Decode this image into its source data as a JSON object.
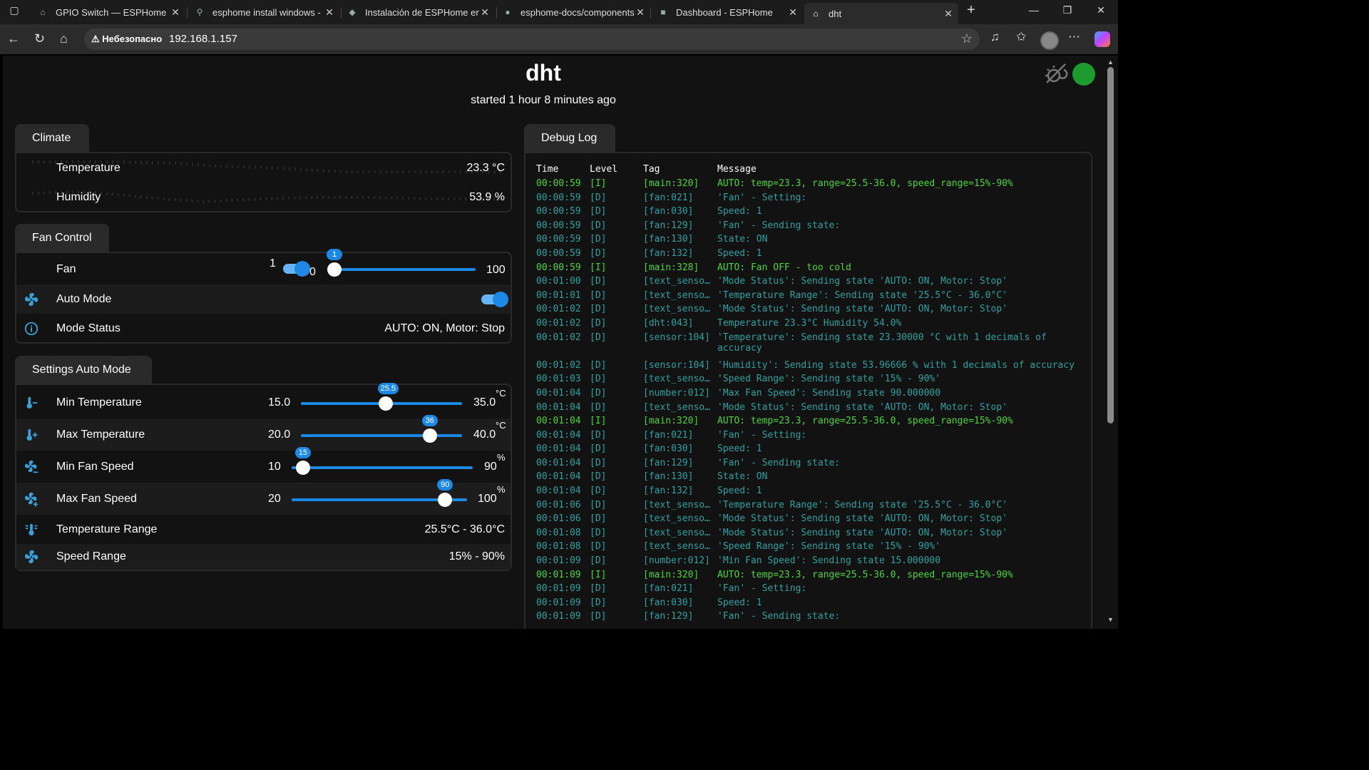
{
  "browser": {
    "tabs": [
      {
        "title": "GPIO Switch — ESPHome",
        "icon": "esphome-icon"
      },
      {
        "title": "esphome install windows - I",
        "icon": "search-icon"
      },
      {
        "title": "Instalación de ESPHome en r",
        "icon": "site-icon"
      },
      {
        "title": "esphome-docs/components",
        "icon": "github-icon"
      },
      {
        "title": "Dashboard - ESPHome",
        "icon": "esphome-icon"
      },
      {
        "title": "dht",
        "icon": "home-icon"
      }
    ],
    "security_label": "Небезопасно",
    "url": "192.168.1.157"
  },
  "page": {
    "title": "dht",
    "subtitle": "started 1 hour 8 minutes ago"
  },
  "climate": {
    "tab": "Climate",
    "temperature_label": "Temperature",
    "temperature_value": "23.3 °C",
    "humidity_label": "Humidity",
    "humidity_value": "53.9 %"
  },
  "fan_control": {
    "tab": "Fan Control",
    "fan_label": "Fan",
    "fan_toggle_left": "1",
    "fan_toggle_right": "0",
    "fan_speed_value": "1",
    "fan_speed_max": "100",
    "fan_speed_fraction": 0.0,
    "auto_mode_label": "Auto Mode",
    "auto_mode_on": true,
    "mode_status_label": "Mode Status",
    "mode_status_value": "AUTO: ON, Motor: Stop"
  },
  "settings": {
    "tab": "Settings Auto Mode",
    "sliders": [
      {
        "label": "Min Temperature",
        "min": "15.0",
        "max": "35.0",
        "value": "25.5",
        "unit": "°C",
        "fraction": 0.525
      },
      {
        "label": "Max Temperature",
        "min": "20.0",
        "max": "40.0",
        "value": "36",
        "unit": "°C",
        "fraction": 0.8
      },
      {
        "label": "Min Fan Speed",
        "min": "10",
        "max": "90",
        "value": "15",
        "unit": "%",
        "fraction": 0.0625
      },
      {
        "label": "Max Fan Speed",
        "min": "20",
        "max": "100",
        "value": "90",
        "unit": "%",
        "fraction": 0.875
      }
    ],
    "temp_range_label": "Temperature Range",
    "temp_range_value": "25.5°C - 36.0°C",
    "speed_range_label": "Speed Range",
    "speed_range_value": "15% - 90%"
  },
  "debug_log": {
    "tab": "Debug Log",
    "headers": [
      "Time",
      "Level",
      "Tag",
      "Message"
    ],
    "rows": [
      {
        "time": "00:00:59",
        "level": "[I]",
        "tag": "[main:320]",
        "msg": "AUTO: temp=23.3, range=25.5-36.0, speed_range=15%-90%"
      },
      {
        "time": "00:00:59",
        "level": "[D]",
        "tag": "[fan:021]",
        "msg": "'Fan' - Setting:"
      },
      {
        "time": "00:00:59",
        "level": "[D]",
        "tag": "[fan:030]",
        "msg": "Speed: 1"
      },
      {
        "time": "00:00:59",
        "level": "[D]",
        "tag": "[fan:129]",
        "msg": "'Fan' - Sending state:"
      },
      {
        "time": "00:00:59",
        "level": "[D]",
        "tag": "[fan:130]",
        "msg": "State: ON"
      },
      {
        "time": "00:00:59",
        "level": "[D]",
        "tag": "[fan:132]",
        "msg": "Speed: 1"
      },
      {
        "time": "00:00:59",
        "level": "[I]",
        "tag": "[main:328]",
        "msg": "AUTO: Fan OFF - too cold"
      },
      {
        "time": "00:01:00",
        "level": "[D]",
        "tag": "[text_senso…",
        "msg": "'Mode Status': Sending state 'AUTO: ON, Motor: Stop'"
      },
      {
        "time": "00:01:01",
        "level": "[D]",
        "tag": "[text_senso…",
        "msg": "'Temperature Range': Sending state '25.5°C - 36.0°C'"
      },
      {
        "time": "00:01:02",
        "level": "[D]",
        "tag": "[text_senso…",
        "msg": "'Mode Status': Sending state 'AUTO: ON, Motor: Stop'"
      },
      {
        "time": "00:01:02",
        "level": "[D]",
        "tag": "[dht:043]",
        "msg": "Temperature 23.3°C Humidity 54.0%"
      },
      {
        "time": "00:01:02",
        "level": "[D]",
        "tag": "[sensor:104]",
        "msg": "'Temperature': Sending state 23.30000 °C with 1 decimals of\naccuracy"
      },
      {
        "time": "00:01:02",
        "level": "[D]",
        "tag": "[sensor:104]",
        "msg": "'Humidity': Sending state 53.96666 % with 1 decimals of accuracy"
      },
      {
        "time": "00:01:03",
        "level": "[D]",
        "tag": "[text_senso…",
        "msg": "'Speed Range': Sending state '15% - 90%'"
      },
      {
        "time": "00:01:04",
        "level": "[D]",
        "tag": "[number:012]",
        "msg": "'Max Fan Speed': Sending state 90.000000"
      },
      {
        "time": "00:01:04",
        "level": "[D]",
        "tag": "[text_senso…",
        "msg": "'Mode Status': Sending state 'AUTO: ON, Motor: Stop'"
      },
      {
        "time": "00:01:04",
        "level": "[I]",
        "tag": "[main:320]",
        "msg": "AUTO: temp=23.3, range=25.5-36.0, speed_range=15%-90%"
      },
      {
        "time": "00:01:04",
        "level": "[D]",
        "tag": "[fan:021]",
        "msg": "'Fan' - Setting:"
      },
      {
        "time": "00:01:04",
        "level": "[D]",
        "tag": "[fan:030]",
        "msg": "Speed: 1"
      },
      {
        "time": "00:01:04",
        "level": "[D]",
        "tag": "[fan:129]",
        "msg": "'Fan' - Sending state:"
      },
      {
        "time": "00:01:04",
        "level": "[D]",
        "tag": "[fan:130]",
        "msg": "State: ON"
      },
      {
        "time": "00:01:04",
        "level": "[D]",
        "tag": "[fan:132]",
        "msg": "Speed: 1"
      },
      {
        "time": "00:01:06",
        "level": "[D]",
        "tag": "[text_senso…",
        "msg": "'Temperature Range': Sending state '25.5°C - 36.0°C'"
      },
      {
        "time": "00:01:06",
        "level": "[D]",
        "tag": "[text_senso…",
        "msg": "'Mode Status': Sending state 'AUTO: ON, Motor: Stop'"
      },
      {
        "time": "00:01:08",
        "level": "[D]",
        "tag": "[text_senso…",
        "msg": "'Mode Status': Sending state 'AUTO: ON, Motor: Stop'"
      },
      {
        "time": "00:01:08",
        "level": "[D]",
        "tag": "[text_senso…",
        "msg": "'Speed Range': Sending state '15% - 90%'"
      },
      {
        "time": "00:01:09",
        "level": "[D]",
        "tag": "[number:012]",
        "msg": "'Min Fan Speed': Sending state 15.000000"
      },
      {
        "time": "00:01:09",
        "level": "[I]",
        "tag": "[main:320]",
        "msg": "AUTO: temp=23.3, range=25.5-36.0, speed_range=15%-90%"
      },
      {
        "time": "00:01:09",
        "level": "[D]",
        "tag": "[fan:021]",
        "msg": "'Fan' - Setting:"
      },
      {
        "time": "00:01:09",
        "level": "[D]",
        "tag": "[fan:030]",
        "msg": "Speed: 1"
      },
      {
        "time": "00:01:09",
        "level": "[D]",
        "tag": "[fan:129]",
        "msg": "'Fan' - Sending state:"
      }
    ]
  },
  "colors": {
    "accent": "#1e88e5",
    "log_info": "#4cd43a",
    "log_debug": "#2fa0a0",
    "status_online": "#1e9b2e"
  }
}
